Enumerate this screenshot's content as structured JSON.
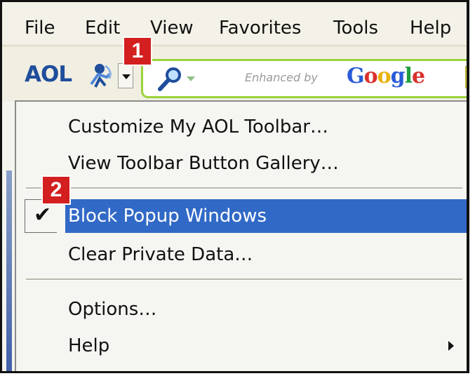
{
  "menubar": {
    "items": [
      "File",
      "Edit",
      "View",
      "Favorites",
      "Tools",
      "Help"
    ]
  },
  "toolbar": {
    "logo_text": "AOL",
    "enhanced_by": "Enhanced by",
    "google_letters": [
      "G",
      "o",
      "o",
      "g",
      "l",
      "e"
    ],
    "google_colors": [
      "#2a5bd7",
      "#d9302c",
      "#e8b20c",
      "#2a5bd7",
      "#1e9e3b",
      "#d9302c"
    ]
  },
  "badges": {
    "one": "1",
    "two": "2"
  },
  "dropdown": {
    "items": [
      {
        "label": "Customize My AOL Toolbar…"
      },
      {
        "label": "View Toolbar Button Gallery…"
      },
      {
        "label": "Block Popup Windows",
        "checked": true,
        "highlighted": true
      },
      {
        "label": "Clear Private Data…"
      },
      {
        "label": "Options…"
      },
      {
        "label": "Help",
        "has_submenu": true
      }
    ]
  },
  "colors": {
    "highlight": "#3169c6",
    "badge": "#d31f1f",
    "search_border": "#9bd33a"
  },
  "icons": [
    "aol-running-man-icon",
    "dropdown-arrow-icon",
    "magnifier-icon",
    "checkmark-icon",
    "submenu-arrow-icon"
  ]
}
